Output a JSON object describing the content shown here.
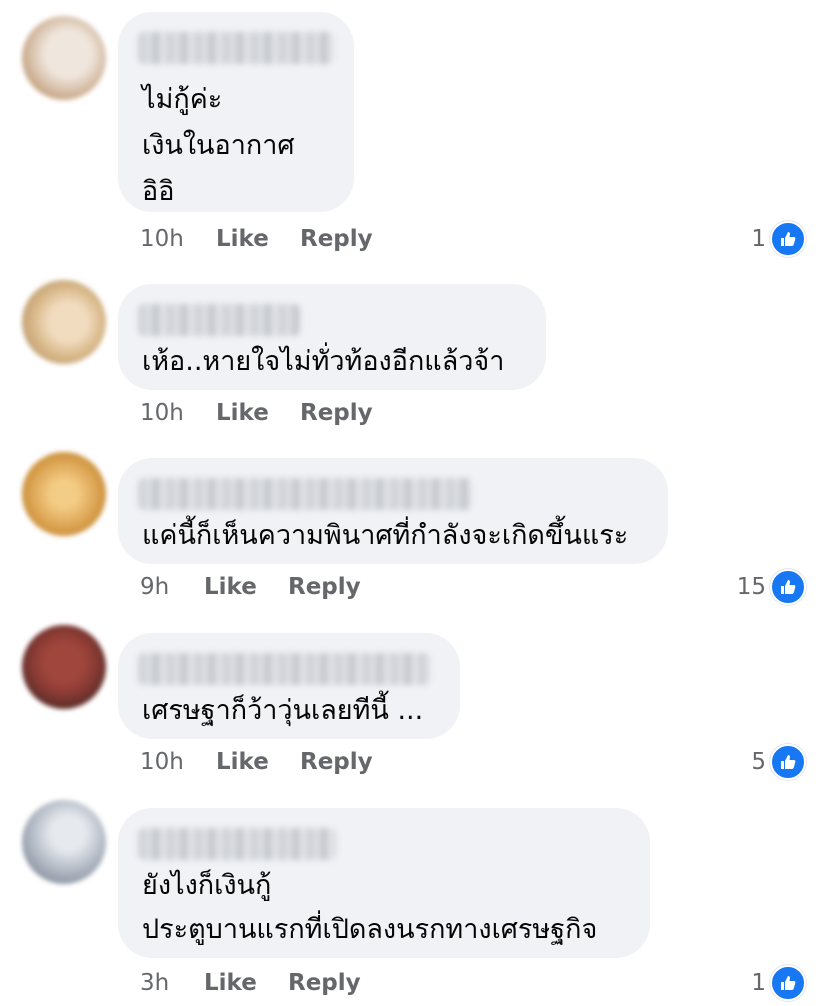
{
  "colors": {
    "bubble": "#f0f2f5",
    "text": "#050505",
    "meta": "#65676b",
    "like_blue": "#1877f2"
  },
  "comments": [
    {
      "lines": [
        "ไม่กู้ค่ะ",
        "เงินในอากาศ",
        "อิอิ"
      ],
      "time": "10h",
      "like_label": "Like",
      "reply_label": "Reply",
      "reactions": "1",
      "avatar_colors": [
        "#efe6dd",
        "#c9a98a"
      ]
    },
    {
      "lines": [
        "เห้อ..หายใจไม่ทั่วท้องอีกแล้วจ้า"
      ],
      "time": "10h",
      "like_label": "Like",
      "reply_label": "Reply",
      "reactions": "",
      "avatar_colors": [
        "#d9b98a",
        "#a7835a"
      ]
    },
    {
      "lines": [
        "แค่นี้ก็เห็นความพินาศที่กำลังจะเกิดขึ้นแระ"
      ],
      "time": "9h",
      "like_label": "Like",
      "reply_label": "Reply",
      "reactions": "15",
      "avatar_colors": [
        "#e8b66a",
        "#c98d36"
      ]
    },
    {
      "lines": [
        "เศรษฐาก็ว้าวุ่นเลยทีนี้ ..."
      ],
      "time": "10h",
      "like_label": "Like",
      "reply_label": "Reply",
      "reactions": "5",
      "avatar_colors": [
        "#8a3b34",
        "#3b2320"
      ]
    },
    {
      "lines": [
        "ยังไงก็เงินกู้",
        "ประตูบานแรกที่เปิดลงนรกทางเศรษฐกิจ"
      ],
      "time": "3h",
      "like_label": "Like",
      "reply_label": "Reply",
      "reactions": "1",
      "avatar_colors": [
        "#d7dbe2",
        "#7d8796"
      ]
    }
  ]
}
